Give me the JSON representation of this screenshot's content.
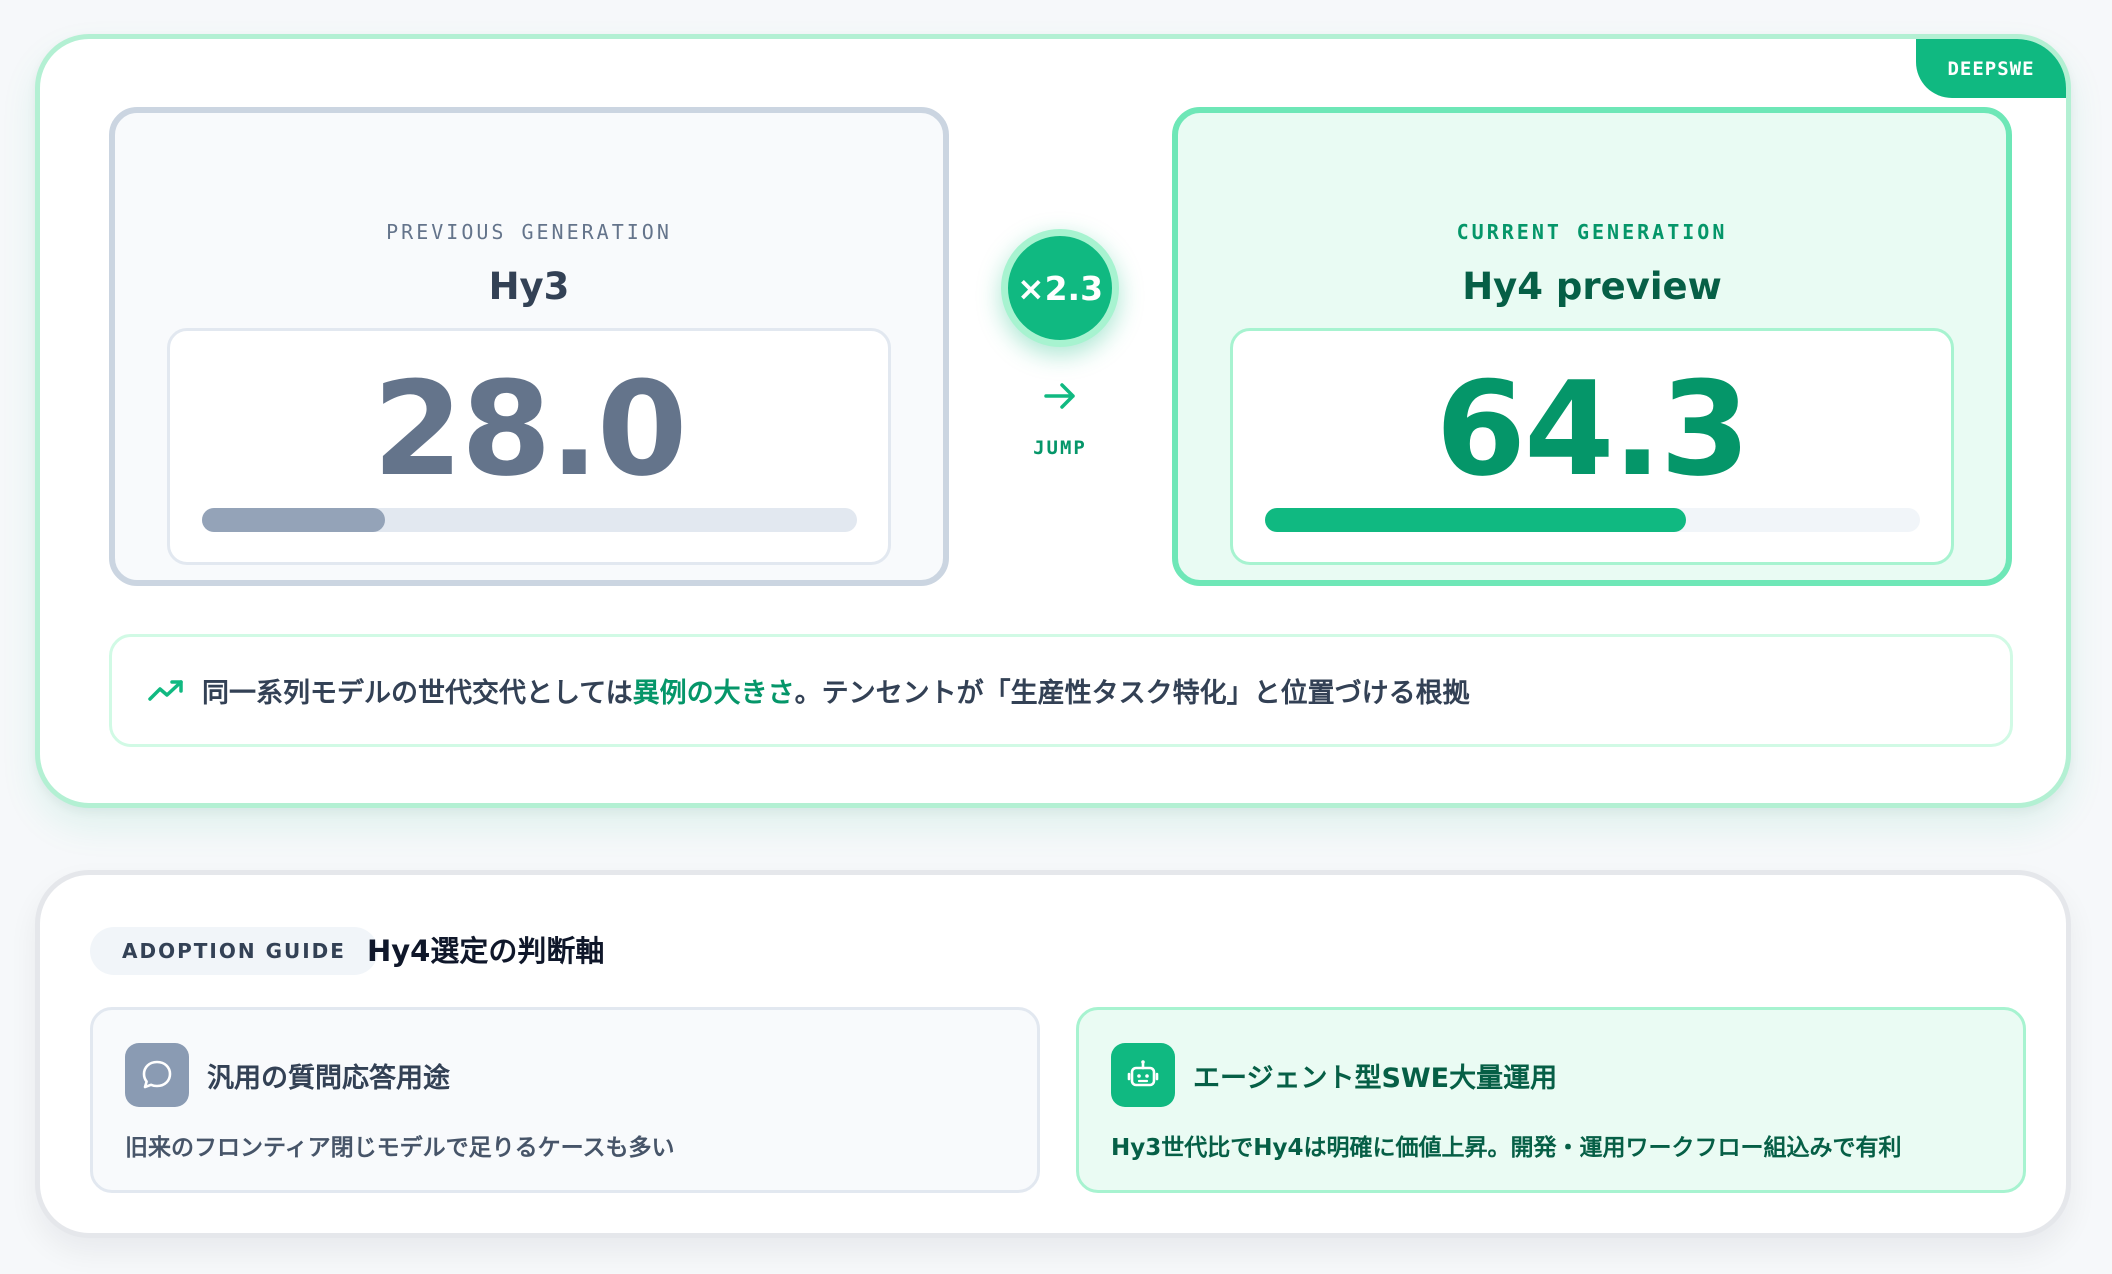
{
  "badge": {
    "label": "DEEPSWE"
  },
  "previous": {
    "label": "PREVIOUS GENERATION",
    "model": "Hy3",
    "score": "28.0",
    "bar_fraction": 0.28
  },
  "current": {
    "label": "CURRENT GENERATION",
    "model": "Hy4 preview",
    "score": "64.3",
    "bar_fraction": 0.643
  },
  "jump": {
    "multiplier": "×2.3",
    "label": "JUMP",
    "icon": "arrow-right-icon"
  },
  "note": {
    "icon": "trending-up-icon",
    "text_before": "同一系列モデルの世代交代としては",
    "text_emphasis": "異例の大きさ",
    "text_after": "。テンセントが「生産性タスク特化」と位置づける根拠"
  },
  "guide": {
    "pill": "ADOPTION GUIDE",
    "title": "Hy4選定の判断軸",
    "options": [
      {
        "icon": "chat-bubble-icon",
        "title": "汎用の質問応答用途",
        "desc": "旧来のフロンティア閉じモデルで足りるケースも多い"
      },
      {
        "icon": "robot-icon",
        "title": "エージェント型SWE大量運用",
        "desc": "Hy3世代比でHy4は明確に価値上昇。開発・運用ワークフロー組込みで有利"
      }
    ]
  },
  "colors": {
    "accent": "#10b981",
    "accent_dark": "#059669",
    "muted": "#64748b"
  }
}
